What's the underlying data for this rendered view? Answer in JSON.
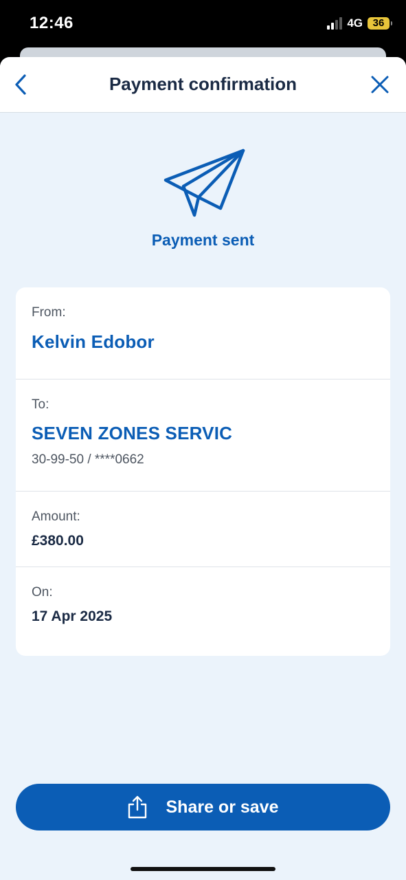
{
  "status_bar": {
    "time": "12:46",
    "network": "4G",
    "battery": "36",
    "signal_bars_active": 2,
    "signal_bars_total": 4
  },
  "header": {
    "title": "Payment confirmation",
    "back_icon": "chevron-left-icon",
    "close_icon": "close-icon"
  },
  "hero": {
    "icon": "paper-plane-icon",
    "status_text": "Payment sent"
  },
  "details": {
    "from_label": "From:",
    "from_name": "Kelvin Edobor",
    "to_label": "To:",
    "to_name": "SEVEN ZONES SERVIC",
    "to_account": "30-99-50 / ****0662",
    "amount_label": "Amount:",
    "amount_value": "£380.00",
    "date_label": "On:",
    "date_value": "17 Apr 2025"
  },
  "actions": {
    "share_label": "Share or save",
    "share_icon": "share-icon"
  },
  "colors": {
    "accent": "#0b5db5",
    "background": "#ebf3fb",
    "title_text": "#1a2a44"
  }
}
